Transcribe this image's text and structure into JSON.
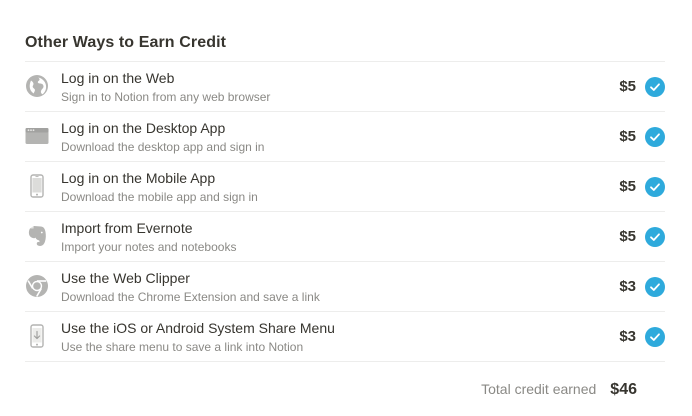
{
  "section": {
    "title": "Other Ways to Earn Credit"
  },
  "colors": {
    "accent": "#2eaadc",
    "icon": "#b4b4b2",
    "muted": "#8a8985",
    "text": "#37352f",
    "divider": "#ededec"
  },
  "rows": [
    {
      "icon": "globe-icon",
      "title": "Log in on the Web",
      "subtitle": "Sign in to Notion from any web browser",
      "amount": "$5",
      "completed": true
    },
    {
      "icon": "desktop-window-icon",
      "title": "Log in on the Desktop App",
      "subtitle": "Download the desktop app and sign in",
      "amount": "$5",
      "completed": true
    },
    {
      "icon": "mobile-phone-icon",
      "title": "Log in on the Mobile App",
      "subtitle": "Download the mobile app and sign in",
      "amount": "$5",
      "completed": true
    },
    {
      "icon": "evernote-elephant-icon",
      "title": "Import from Evernote",
      "subtitle": "Import your notes and notebooks",
      "amount": "$5",
      "completed": true
    },
    {
      "icon": "chrome-icon",
      "title": "Use the Web Clipper",
      "subtitle": "Download the Chrome Extension and save a link",
      "amount": "$3",
      "completed": true
    },
    {
      "icon": "phone-share-icon",
      "title": "Use the iOS or Android System Share Menu",
      "subtitle": "Use the share menu to save a link into Notion",
      "amount": "$3",
      "completed": true
    }
  ],
  "total": {
    "label": "Total credit earned",
    "value": "$46"
  }
}
